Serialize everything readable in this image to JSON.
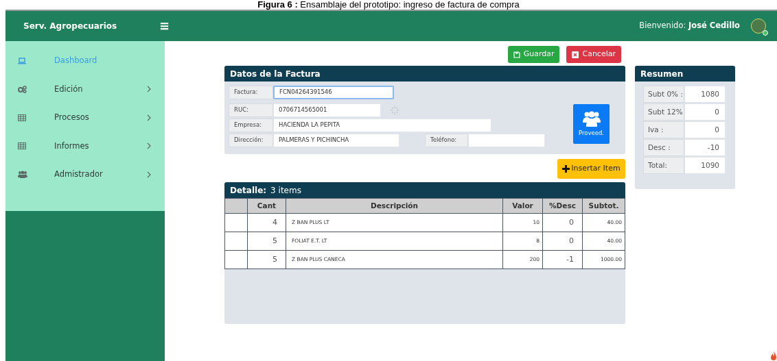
{
  "caption": {
    "bold": "Figura 6 :",
    "text": "Ensamblaje del prototipo: ingreso de factura de compra"
  },
  "header": {
    "brand": "Serv. Agropecuarios",
    "menu_glyph": "≡",
    "welcome": "Bienvenido:",
    "user": "José Cedillo"
  },
  "sidebar": {
    "items": [
      {
        "label": "Dashboard",
        "selected": true,
        "expandable": false
      },
      {
        "label": "Edición",
        "selected": false,
        "expandable": true
      },
      {
        "label": "Procesos",
        "selected": false,
        "expandable": true
      },
      {
        "label": "Informes",
        "selected": false,
        "expandable": true
      },
      {
        "label": "Admistrador",
        "selected": false,
        "expandable": true
      }
    ]
  },
  "actions": [
    {
      "label": "Guardar",
      "kind": "save"
    },
    {
      "label": "Cancelar",
      "kind": "cancel"
    }
  ],
  "invoice": {
    "title": "Datos de la Factura",
    "fields": [
      {
        "label": "Factura:",
        "value": "FCN04264391546",
        "focused": true
      },
      {
        "label": "RUC:",
        "value": "0706714565001",
        "focused": false
      },
      {
        "label": "Empresa:",
        "value": "HACIENDA LA PEPITA",
        "focused": false
      },
      {
        "label": "Dirección:",
        "value": "PALMERAS Y PICHINCHA",
        "focused": false
      }
    ],
    "phone_label": "Teléfono:",
    "supplier_button": "Proveed."
  },
  "insert_button": "Insertar Item",
  "summary": {
    "title": "Resumen",
    "rows": [
      {
        "label": "Subt 0% :",
        "value": "1080"
      },
      {
        "label": "Subt 12%",
        "value": "0"
      },
      {
        "label": "Iva :",
        "value": "0"
      },
      {
        "label": "Desc :",
        "value": "-10"
      },
      {
        "label": "Total:",
        "value": "1090"
      }
    ]
  },
  "detail": {
    "title": "Detalle:",
    "count": "3 items",
    "columns": [
      "Cant",
      "Descripción",
      "Valor",
      "%Desc",
      "Subtot."
    ],
    "rows": [
      [
        "4",
        "Z BAN PLUS LT",
        "10",
        "0",
        "40.00"
      ],
      [
        "5",
        "FOLIAT E.T. LT",
        "8",
        "0",
        "40.00"
      ],
      [
        "5",
        "Z BAN PLUS CANECA",
        "200",
        "-1",
        "1000.00"
      ]
    ]
  }
}
